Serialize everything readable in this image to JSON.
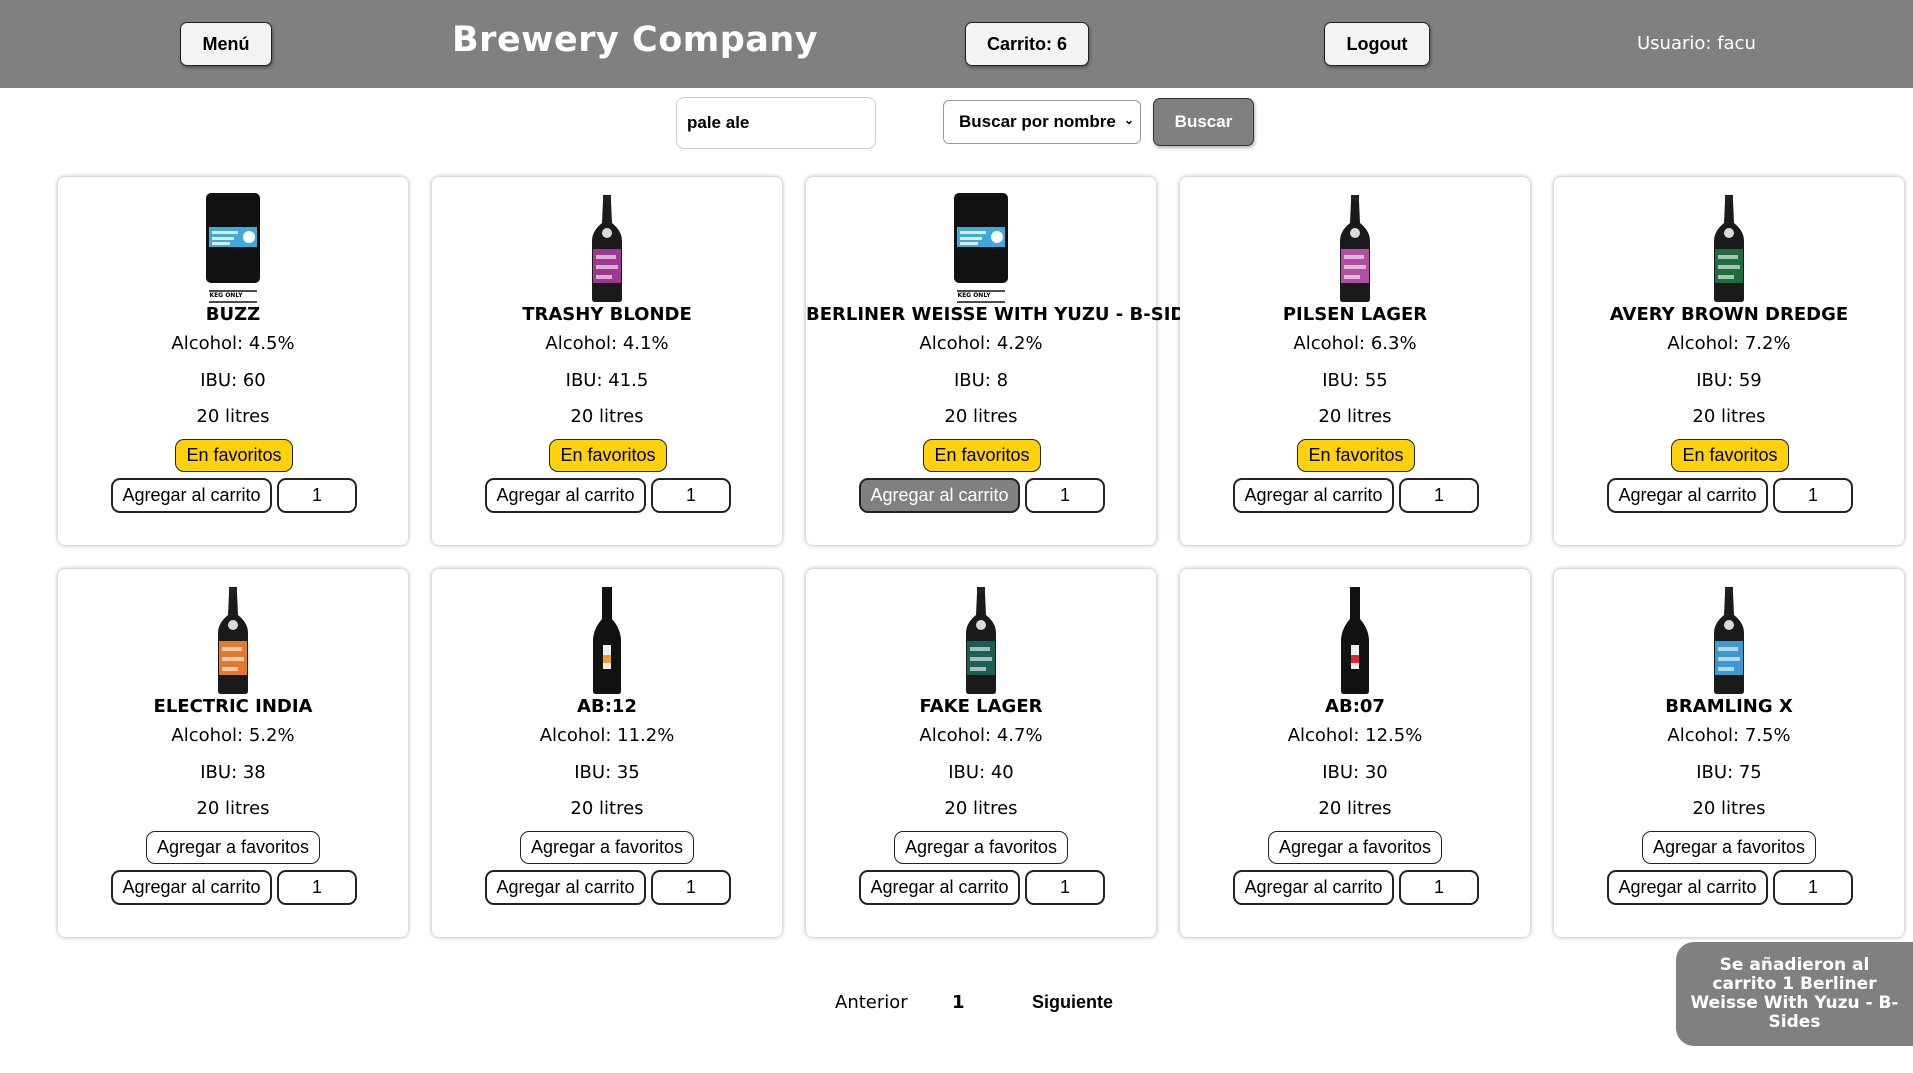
{
  "header": {
    "menu_label": "Menú",
    "brand": "Brewery Company",
    "cart_label": "Carrito: 6",
    "logout_label": "Logout",
    "user_label": "Usuario: facu"
  },
  "search": {
    "value": "pale ale",
    "mode": "Buscar por nombre",
    "button_label": "Buscar"
  },
  "products": [
    {
      "name": "BUZZ",
      "alcohol": "Alcohol: 4.5%",
      "ibu": "IBU: 60",
      "volume": "20 litres",
      "fav_label": "En favoritos",
      "in_favorites": true,
      "cart_label": "Agregar al carrito",
      "qty": "1",
      "image": "keg-icon",
      "label_color": "#3fa9d9",
      "keg_text": "KEG ONLY"
    },
    {
      "name": "TRASHY BLONDE",
      "alcohol": "Alcohol: 4.1%",
      "ibu": "IBU: 41.5",
      "volume": "20 litres",
      "fav_label": "En favoritos",
      "in_favorites": true,
      "cart_label": "Agregar al carrito",
      "qty": "1",
      "image": "bottle-icon",
      "label_color": "#9b3a8f"
    },
    {
      "name": "BERLINER WEISSE WITH YUZU - B-SIDES",
      "alcohol": "Alcohol: 4.2%",
      "ibu": "IBU: 8",
      "volume": "20 litres",
      "fav_label": "En favoritos",
      "in_favorites": true,
      "cart_label": "Agregar al carrito",
      "qty": "1",
      "image": "keg-icon",
      "label_color": "#3fa9d9",
      "keg_text": "KEG ONLY",
      "cart_active": true
    },
    {
      "name": "PILSEN LAGER",
      "alcohol": "Alcohol: 6.3%",
      "ibu": "IBU: 55",
      "volume": "20 litres",
      "fav_label": "En favoritos",
      "in_favorites": true,
      "cart_label": "Agregar al carrito",
      "qty": "1",
      "image": "bottle-icon",
      "label_color": "#b14fa0"
    },
    {
      "name": "AVERY BROWN DREDGE",
      "alcohol": "Alcohol: 7.2%",
      "ibu": "IBU: 59",
      "volume": "20 litres",
      "fav_label": "En favoritos",
      "in_favorites": true,
      "cart_label": "Agregar al carrito",
      "qty": "1",
      "image": "bottle-icon",
      "label_color": "#1f6b3d"
    },
    {
      "name": "ELECTRIC INDIA",
      "alcohol": "Alcohol: 5.2%",
      "ibu": "IBU: 38",
      "volume": "20 litres",
      "fav_label": "Agregar a favoritos",
      "in_favorites": false,
      "cart_label": "Agregar al carrito",
      "qty": "1",
      "image": "bottle-icon",
      "label_color": "#e07a2e"
    },
    {
      "name": "AB:12",
      "alcohol": "Alcohol: 11.2%",
      "ibu": "IBU: 35",
      "volume": "20 litres",
      "fav_label": "Agregar a favoritos",
      "in_favorites": false,
      "cart_label": "Agregar al carrito",
      "qty": "1",
      "image": "wine-bottle-icon",
      "label_color": "#f0a020"
    },
    {
      "name": "FAKE LAGER",
      "alcohol": "Alcohol: 4.7%",
      "ibu": "IBU: 40",
      "volume": "20 litres",
      "fav_label": "Agregar a favoritos",
      "in_favorites": false,
      "cart_label": "Agregar al carrito",
      "qty": "1",
      "image": "bottle-icon",
      "label_color": "#1d5e52"
    },
    {
      "name": "AB:07",
      "alcohol": "Alcohol: 12.5%",
      "ibu": "IBU: 30",
      "volume": "20 litres",
      "fav_label": "Agregar a favoritos",
      "in_favorites": false,
      "cart_label": "Agregar al carrito",
      "qty": "1",
      "image": "wine-bottle-icon",
      "label_color": "#d9253b"
    },
    {
      "name": "BRAMLING X",
      "alcohol": "Alcohol: 7.5%",
      "ibu": "IBU: 75",
      "volume": "20 litres",
      "fav_label": "Agregar a favoritos",
      "in_favorites": false,
      "cart_label": "Agregar al carrito",
      "qty": "1",
      "image": "bottle-icon",
      "label_color": "#3b9bd0"
    }
  ],
  "pagination": {
    "prev_label": "Anterior",
    "page": "1",
    "next_label": "Siguiente"
  },
  "toast": {
    "message": "Se añadieron al carrito 1 Berliner Weisse With Yuzu - B-Sides"
  }
}
